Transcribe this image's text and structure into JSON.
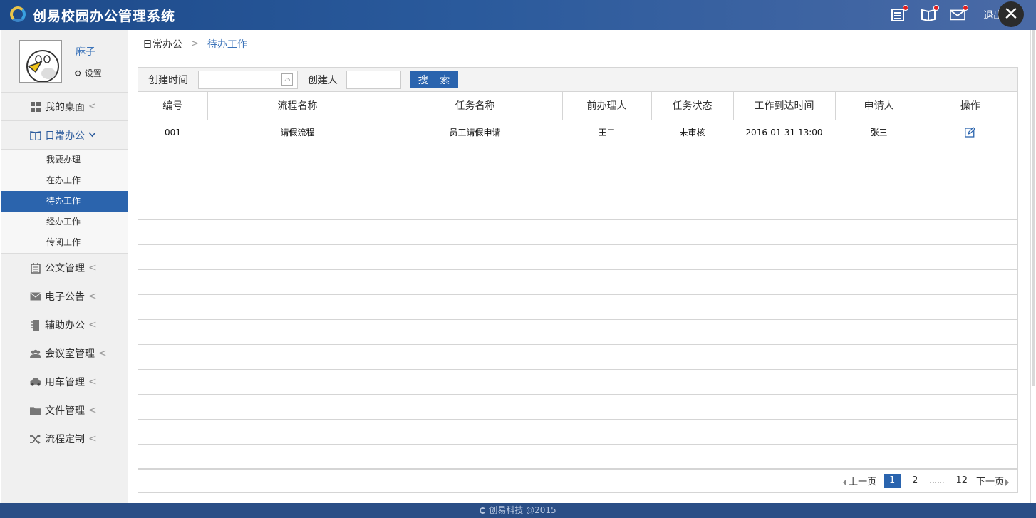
{
  "header": {
    "title": "创易校园办公管理系统",
    "logout": "退出",
    "close": "✕"
  },
  "user": {
    "name": "麻子",
    "settings": "设置"
  },
  "menu": [
    {
      "label": "我的桌面",
      "icon": "dashboard-icon"
    },
    {
      "label": "日常办公",
      "icon": "book-icon",
      "open": true
    }
  ],
  "submenu": [
    "我要办理",
    "在办工作",
    "待办工作",
    "经办工作",
    "传阅工作"
  ],
  "menu_rest": [
    {
      "label": "公文管理",
      "icon": "document-icon"
    },
    {
      "label": "电子公告",
      "icon": "mail-icon"
    },
    {
      "label": "辅助办公",
      "icon": "binder-icon"
    },
    {
      "label": "会议室管理",
      "icon": "people-icon"
    },
    {
      "label": "用车管理",
      "icon": "car-icon"
    },
    {
      "label": "文件管理",
      "icon": "folder-icon"
    },
    {
      "label": "流程定制",
      "icon": "shuffle-icon"
    }
  ],
  "breadcrumb": {
    "parent": "日常办公",
    "current": "待办工作"
  },
  "search": {
    "created_time_label": "创建时间",
    "creator_label": "创建人",
    "button": "搜 索",
    "calendar_day": "25"
  },
  "table": {
    "headers": [
      "编号",
      "流程名称",
      "任务名称",
      "前办理人",
      "任务状态",
      "工作到达时间",
      "申请人",
      "操作"
    ],
    "rows": [
      [
        "001",
        "请假流程",
        "员工请假申请",
        "王二",
        "未审核",
        "2016-01-31 13:00",
        "张三"
      ]
    ]
  },
  "pager": {
    "prev": "上一页",
    "pages": [
      "1",
      "2",
      "......",
      "12"
    ],
    "next": "下一页"
  },
  "footer": "创易科技 @2015",
  "colors": {
    "header": "#2a5a9c",
    "accent": "#2b64ad",
    "footer": "#2a4e86"
  }
}
